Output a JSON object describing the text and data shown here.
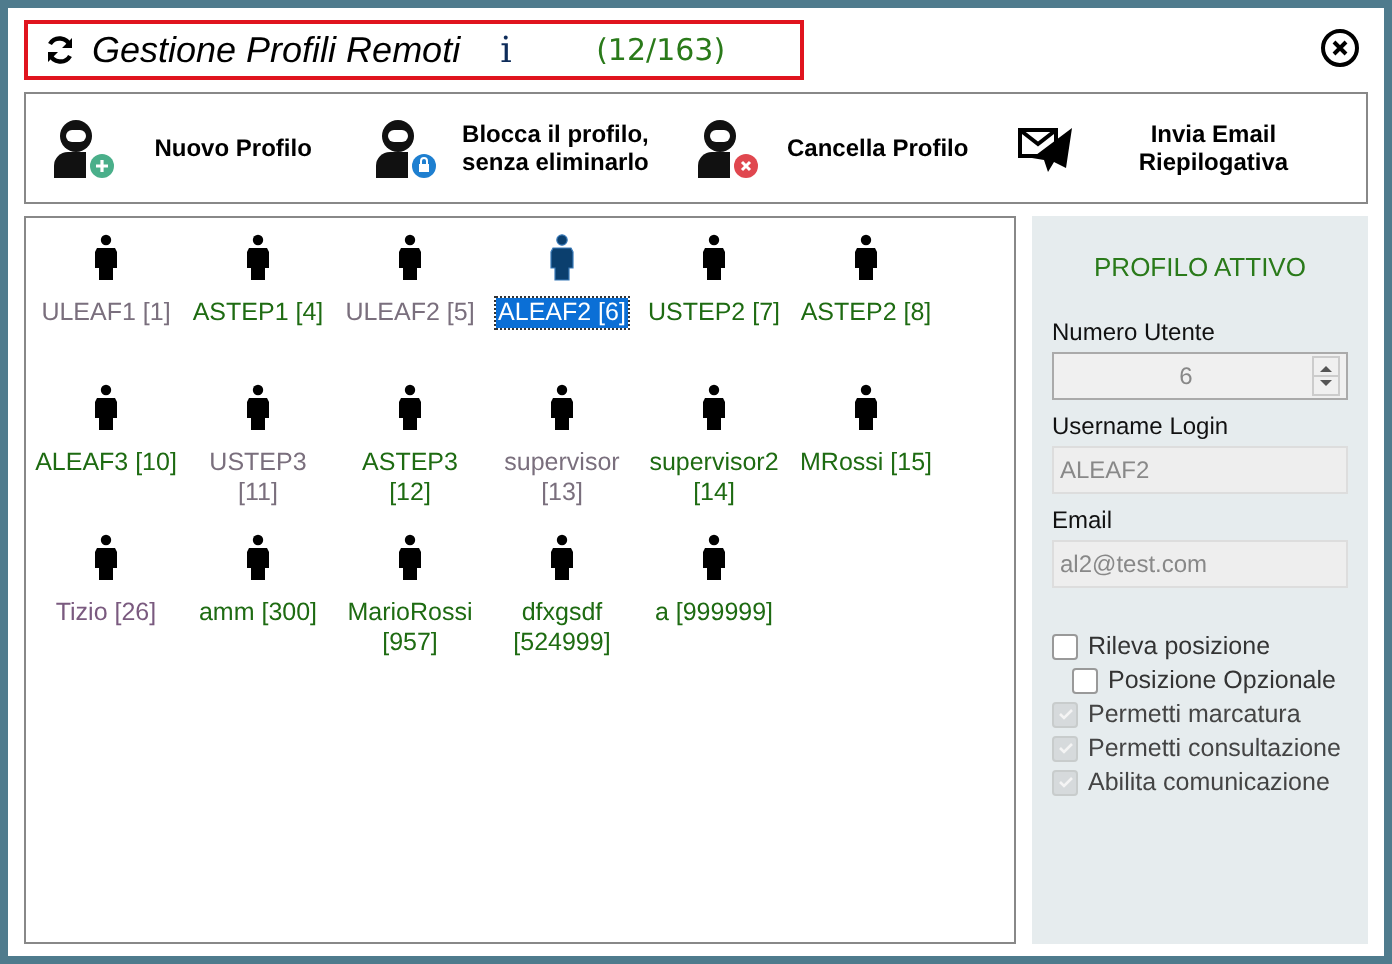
{
  "window": {
    "title": "Gestione Profili Remoti",
    "info": "i",
    "count": "(12/163)"
  },
  "toolbar": [
    {
      "kind": "add",
      "label": "Nuovo Profilo"
    },
    {
      "kind": "lock",
      "label": "Blocca il profilo, senza eliminarlo"
    },
    {
      "kind": "delete",
      "label": "Cancella Profilo"
    },
    {
      "kind": "email",
      "label": "Invia Email Riepilogativa"
    }
  ],
  "profiles": [
    {
      "label": "ULEAF1 [1]",
      "color": "#7a6f7d",
      "selected": false
    },
    {
      "label": "ASTEP1 [4]",
      "color": "#1e6b12",
      "selected": false
    },
    {
      "label": "ULEAF2 [5]",
      "color": "#7a6f7d",
      "selected": false
    },
    {
      "label": "ALEAF2 [6]",
      "selected": true
    },
    {
      "label": "USTEP2 [7]",
      "color": "#1e6b12",
      "selected": false
    },
    {
      "label": "ASTEP2 [8]",
      "color": "#1e6b12",
      "selected": false
    },
    {
      "label": "ALEAF3 [10]",
      "color": "#1e6b12",
      "selected": false
    },
    {
      "label": "USTEP3 [11]",
      "color": "#7a6f7d",
      "selected": false
    },
    {
      "label": "ASTEP3 [12]",
      "color": "#1e6b12",
      "selected": false
    },
    {
      "label": "supervisor [13]",
      "color": "#7a6f7d",
      "selected": false
    },
    {
      "label": "supervisor2 [14]",
      "color": "#1e6b12",
      "selected": false
    },
    {
      "label": "MRossi [15]",
      "color": "#1e6b12",
      "selected": false
    },
    {
      "label": "Tizio [26]",
      "color": "#7a5a7f",
      "selected": false
    },
    {
      "label": "amm [300]",
      "color": "#1e6b12",
      "selected": false
    },
    {
      "label": "MarioRossi [957]",
      "color": "#1e6b12",
      "selected": false
    },
    {
      "label": "dfxgsdf [524999]",
      "color": "#1e6b12",
      "selected": false
    },
    {
      "label": "a [999999]",
      "color": "#1e6b12",
      "selected": false
    }
  ],
  "active_profile": {
    "heading": "PROFILO ATTIVO",
    "fields": [
      {
        "kind": "spinner",
        "label": "Numero Utente",
        "value": "6"
      },
      {
        "kind": "text",
        "label": "Username Login",
        "value": "ALEAF2"
      },
      {
        "kind": "text",
        "label": "Email",
        "value": "al2@test.com"
      }
    ],
    "options": [
      {
        "label": "Rileva posizione",
        "checked": false,
        "disabled": false,
        "indented": false
      },
      {
        "label": "Posizione Opzionale",
        "checked": false,
        "disabled": false,
        "indented": true
      },
      {
        "label": "Permetti marcatura",
        "checked": true,
        "disabled": true,
        "indented": false
      },
      {
        "label": "Permetti consultazione",
        "checked": true,
        "disabled": true,
        "indented": false
      },
      {
        "label": "Abilita comunicazione",
        "checked": true,
        "disabled": true,
        "indented": false
      }
    ]
  }
}
